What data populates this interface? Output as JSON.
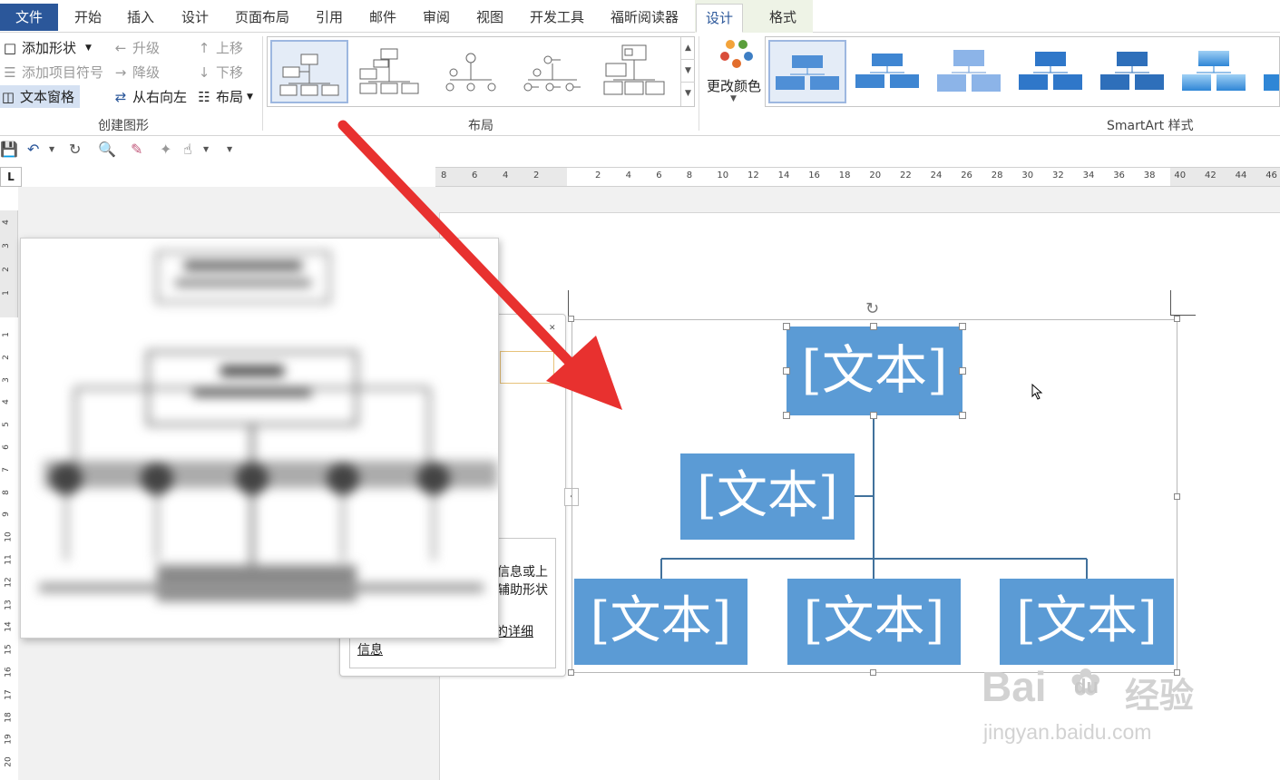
{
  "menu": {
    "tabs": [
      "文件",
      "开始",
      "插入",
      "设计",
      "页面布局",
      "引用",
      "邮件",
      "审阅",
      "视图",
      "开发工具",
      "福昕阅读器",
      "设计",
      "格式"
    ]
  },
  "ribbon": {
    "create_group": {
      "label": "创建图形",
      "add_shape": "添加形状",
      "add_bullet": "添加项目符号",
      "text_pane": "文本窗格",
      "promote": "升级",
      "demote": "降级",
      "right_to_left": "从右向左",
      "move_up": "上移",
      "move_down": "下移",
      "layout": "布局"
    },
    "layout_group": {
      "label": "布局"
    },
    "change_colors": "更改颜色",
    "styles_group": {
      "label": "SmartArt 样式"
    }
  },
  "ruler": {
    "h_left": [
      "8",
      "6",
      "4",
      "2"
    ],
    "h_right": [
      "2",
      "4",
      "6",
      "8",
      "10",
      "12",
      "14",
      "16",
      "18",
      "20",
      "22",
      "24",
      "26",
      "28",
      "30",
      "32",
      "34",
      "36",
      "38",
      "40",
      "42",
      "44",
      "46"
    ],
    "v_top": [
      "4",
      "3",
      "2",
      "1"
    ],
    "v_bottom": [
      "1",
      "2",
      "3",
      "4",
      "5",
      "6",
      "7",
      "8",
      "9",
      "10",
      "11",
      "12",
      "13",
      "14",
      "15",
      "16",
      "17",
      "18",
      "19",
      "20"
    ],
    "corner": "L"
  },
  "text_pane": {
    "line1": "信息或上",
    "line2": "辅助形状",
    "link1": "的详细",
    "link2": "信息"
  },
  "smartart": {
    "top": "[文本]",
    "assistant": "[文本]",
    "child1": "[文本]",
    "child2": "[文本]",
    "child3": "[文本]",
    "color": "#5b9bd5",
    "line_color": "#41719c"
  },
  "annotation": {
    "arrow_color": "#e8312f"
  },
  "watermark": {
    "brand": "Bai",
    "brand2": "du",
    "cn": "经验",
    "url": "jingyan.baidu.com"
  }
}
